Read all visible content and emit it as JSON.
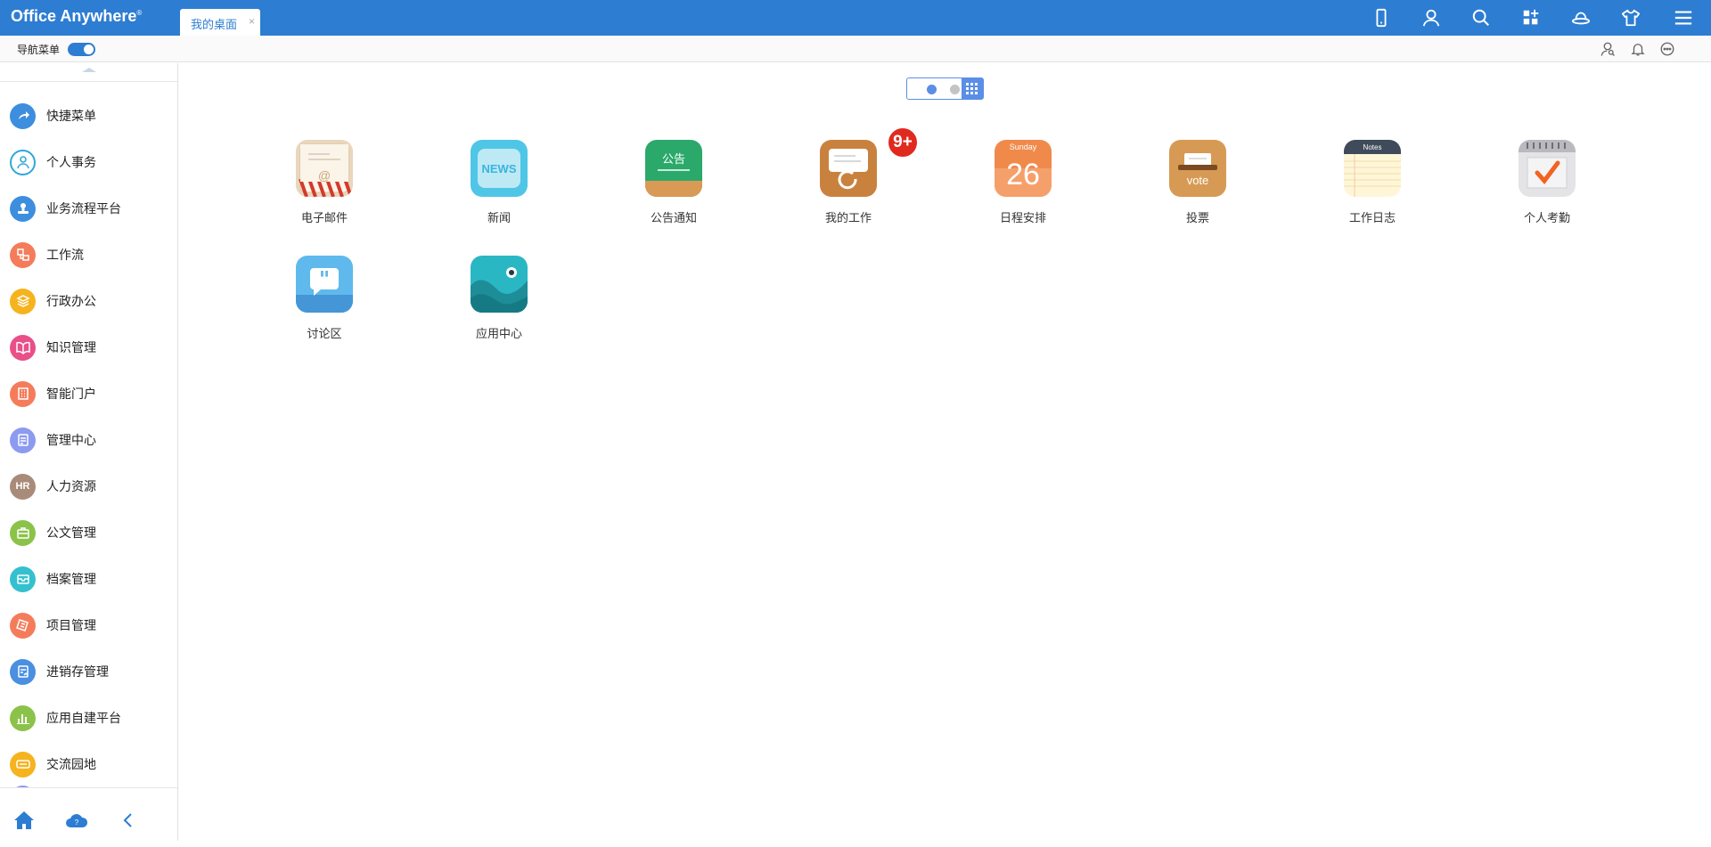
{
  "app": {
    "title": "Office Anywhere",
    "mark": "®"
  },
  "tabs": [
    {
      "label": "我的桌面",
      "close": "×"
    }
  ],
  "toolbar": {
    "icons": [
      "mobile-icon",
      "user-icon",
      "search-icon",
      "apps-add-icon",
      "hat-icon",
      "shirt-icon",
      "menu-icon"
    ]
  },
  "subbar": {
    "nav_label": "导航菜单",
    "nav_toggle_on": true,
    "icons": [
      "user-search-icon",
      "bell-icon",
      "chat-icon"
    ]
  },
  "sidebar": {
    "items": [
      {
        "label": "快捷菜单",
        "color": "#3d8ede",
        "icon": "share-icon"
      },
      {
        "label": "个人事务",
        "color": "#ffffff",
        "icon": "person-icon"
      },
      {
        "label": "业务流程平台",
        "color": "#3d8ede",
        "icon": "stamp-icon"
      },
      {
        "label": "工作流",
        "color": "#f57c5b",
        "icon": "flow-icon"
      },
      {
        "label": "行政办公",
        "color": "#f5b31e",
        "icon": "layers-icon"
      },
      {
        "label": "知识管理",
        "color": "#e94f88",
        "icon": "book-icon"
      },
      {
        "label": "智能门户",
        "color": "#f57c5b",
        "icon": "building-icon"
      },
      {
        "label": "管理中心",
        "color": "#8c9af0",
        "icon": "document-icon"
      },
      {
        "label": "人力资源",
        "color": "#a98b7a",
        "icon": "hr-icon",
        "text": "HR"
      },
      {
        "label": "公文管理",
        "color": "#8bc34a",
        "icon": "briefcase-icon"
      },
      {
        "label": "档案管理",
        "color": "#35c0cf",
        "icon": "archive-icon"
      },
      {
        "label": "项目管理",
        "color": "#f57c5b",
        "icon": "project-icon"
      },
      {
        "label": "进销存管理",
        "color": "#4a8fe0",
        "icon": "inventory-icon"
      },
      {
        "label": "应用自建平台",
        "color": "#8bc34a",
        "icon": "bar-chart-icon"
      },
      {
        "label": "交流园地",
        "color": "#f5b31e",
        "icon": "chat-bubble-icon"
      }
    ],
    "bottom_icons": [
      "home-icon",
      "cloud-help-icon",
      "collapse-icon"
    ]
  },
  "desktop": {
    "pages": 2,
    "current_page": 1,
    "apps": [
      {
        "label": "电子邮件",
        "icon": "mail-icon"
      },
      {
        "label": "新闻",
        "icon": "news-icon",
        "icon_text": "NEWS"
      },
      {
        "label": "公告通知",
        "icon": "notice-icon",
        "icon_text": "公告"
      },
      {
        "label": "我的工作",
        "icon": "work-icon",
        "badge": "9+"
      },
      {
        "label": "日程安排",
        "icon": "calendar-icon",
        "icon_text": "Sunday",
        "icon_number": "26"
      },
      {
        "label": "投票",
        "icon": "vote-icon",
        "icon_text": "vote"
      },
      {
        "label": "工作日志",
        "icon": "notes-icon",
        "icon_text": "Notes"
      },
      {
        "label": "个人考勤",
        "icon": "attendance-icon"
      },
      {
        "label": "讨论区",
        "icon": "discussion-icon"
      },
      {
        "label": "应用中心",
        "icon": "app-center-icon"
      }
    ]
  }
}
